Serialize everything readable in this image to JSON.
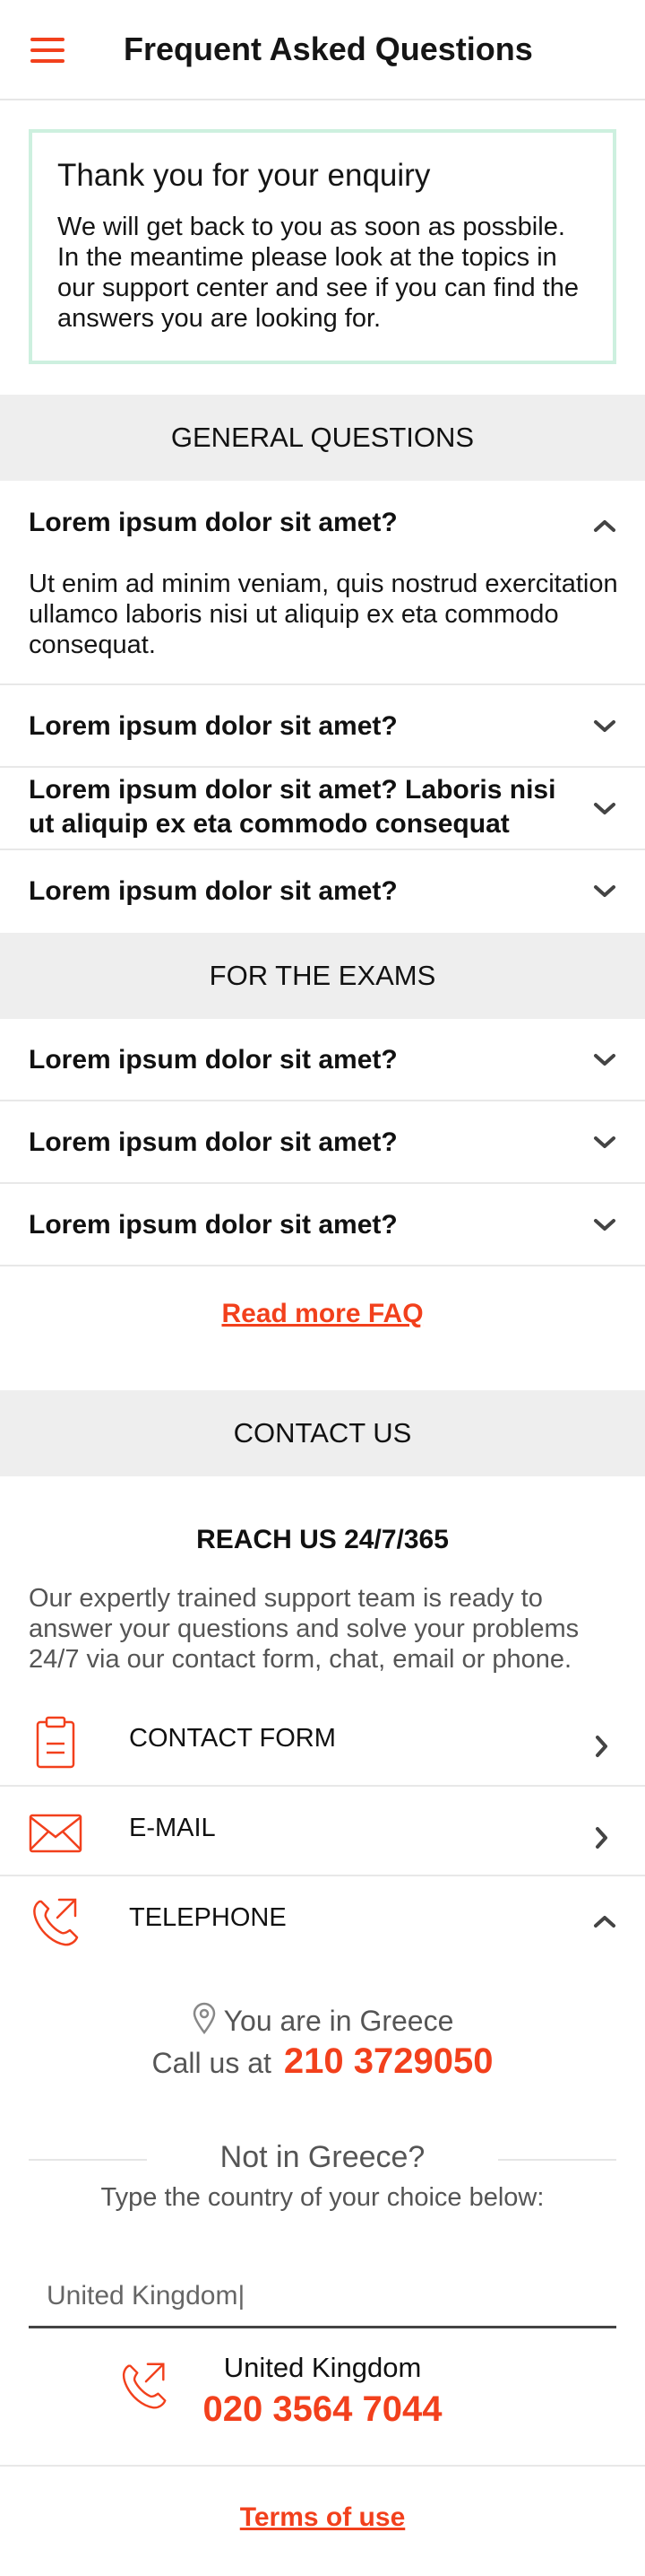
{
  "header": {
    "title": "Frequent Asked Questions",
    "menu_icon": "hamburger-menu-icon"
  },
  "enquiry": {
    "title": "Thank you for your enquiry",
    "text": "We will get back to you as soon as possbile. In the meantime please look at the topics in our support center and see if you can find the answers you are looking for."
  },
  "general": {
    "heading": "GENERAL QUESTIONS",
    "items": [
      {
        "question": "Lorem ipsum dolor sit amet?",
        "answer": "Ut enim ad minim veniam, quis nostrud exercitation ullamco laboris nisi ut aliquip ex eta commodo consequat.",
        "expanded": true
      },
      {
        "question": "Lorem ipsum dolor sit amet?",
        "expanded": false
      },
      {
        "question": "Lorem ipsum dolor sit amet? Laboris nisi ut aliquip ex eta commodo consequat",
        "expanded": false
      },
      {
        "question": "Lorem ipsum dolor sit amet?",
        "expanded": false
      }
    ]
  },
  "exams": {
    "heading": "FOR THE EXAMS",
    "items": [
      {
        "question": "Lorem ipsum dolor sit amet?",
        "expanded": false
      },
      {
        "question": "Lorem ipsum dolor sit amet?",
        "expanded": false
      },
      {
        "question": "Lorem ipsum dolor sit amet?",
        "expanded": false
      }
    ]
  },
  "read_more": "Read more FAQ",
  "contact": {
    "heading": "CONTACT US",
    "reach_title": "REACH US 24/7/365",
    "reach_text": "Our expertly trained support team is ready to answer your questions and solve your problems 24/7 via our contact form, chat, email or phone.",
    "options": [
      {
        "label": "CONTACT FORM",
        "icon": "clipboard-icon",
        "expanded": false
      },
      {
        "label": "E-MAIL",
        "icon": "envelope-icon",
        "expanded": false
      },
      {
        "label": "TELEPHONE",
        "icon": "phone-icon",
        "expanded": true
      }
    ],
    "location_text": "You are in Greece",
    "call_prefix": "Call us at",
    "phone": "210 3729050",
    "not_in": "Not in Greece?",
    "type_country": "Type the country of your choice below:",
    "country_input_value": "United Kingdom|",
    "result_country": "United Kingdom",
    "result_phone": "020 3564 7044"
  },
  "terms": "Terms  of use",
  "colors": {
    "accent": "#f2401c",
    "enquiry_border": "#cdf0df",
    "section_bg": "#eeeeee"
  }
}
